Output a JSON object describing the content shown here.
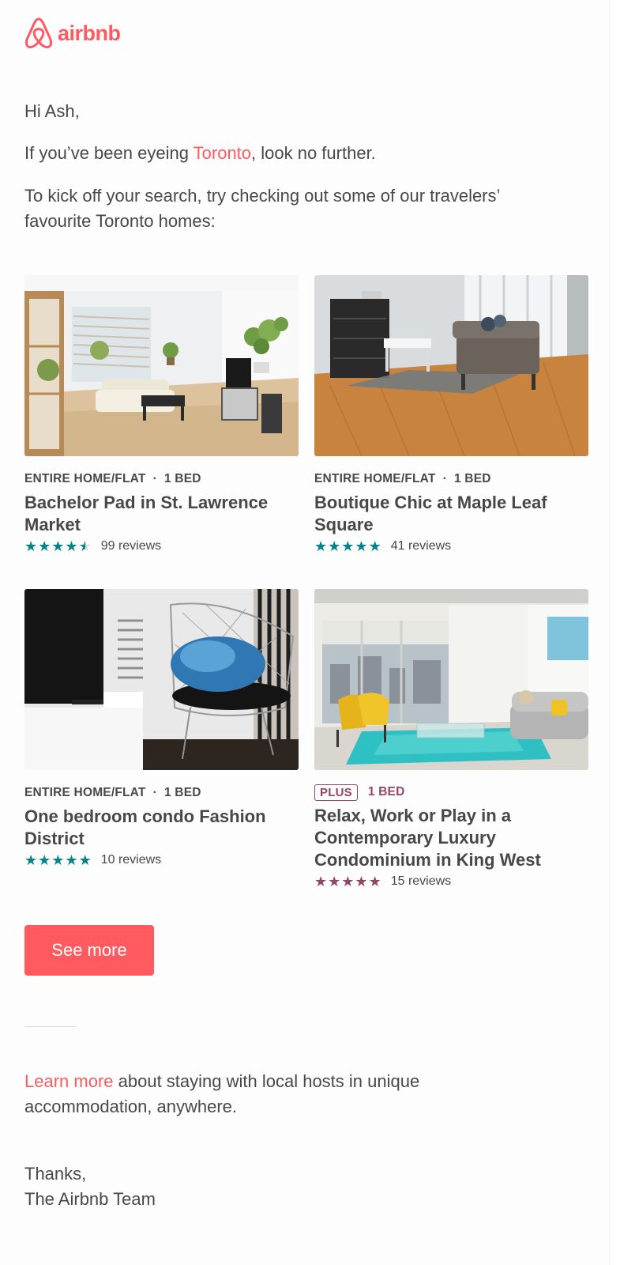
{
  "brand": {
    "name": "airbnb",
    "color": "#FF5A5F",
    "icon": "airbnb-belo-icon"
  },
  "greeting": "Hi Ash,",
  "intro": {
    "before": "If you’ve been eyeing ",
    "city": "Toronto",
    "after": ", look no further."
  },
  "lead": "To kick off your search, try checking out some of our travelers’ favourite Toronto homes:",
  "listings": [
    {
      "type": "ENTIRE HOME/FLAT",
      "separator": "·",
      "beds": "1 BED",
      "title": "Bachelor Pad in St. Lawrence Market",
      "rating": 4.5,
      "reviews": "99 reviews",
      "star_color": "#008489"
    },
    {
      "type": "ENTIRE HOME/FLAT",
      "separator": "·",
      "beds": "1 BED",
      "title": "Boutique Chic at Maple Leaf Square",
      "rating": 5,
      "reviews": "41 reviews",
      "star_color": "#008489"
    },
    {
      "type": "ENTIRE HOME/FLAT",
      "separator": "·",
      "beds": "1 BED",
      "title": "One bedroom condo Fashion District",
      "rating": 5,
      "reviews": "10 reviews",
      "star_color": "#008489"
    },
    {
      "badge": "PLUS",
      "beds": "1 BED",
      "title": "Relax, Work or Play in a Contemporary Luxury Condominium in King West",
      "rating": 5,
      "reviews": "15 reviews",
      "star_color": "#914669"
    }
  ],
  "cta": "See more",
  "learn": {
    "link": "Learn more",
    "text": " about staying with local hosts in unique accommodation, anywhere."
  },
  "signoff": {
    "thanks": "Thanks,",
    "team": "The Airbnb Team"
  }
}
